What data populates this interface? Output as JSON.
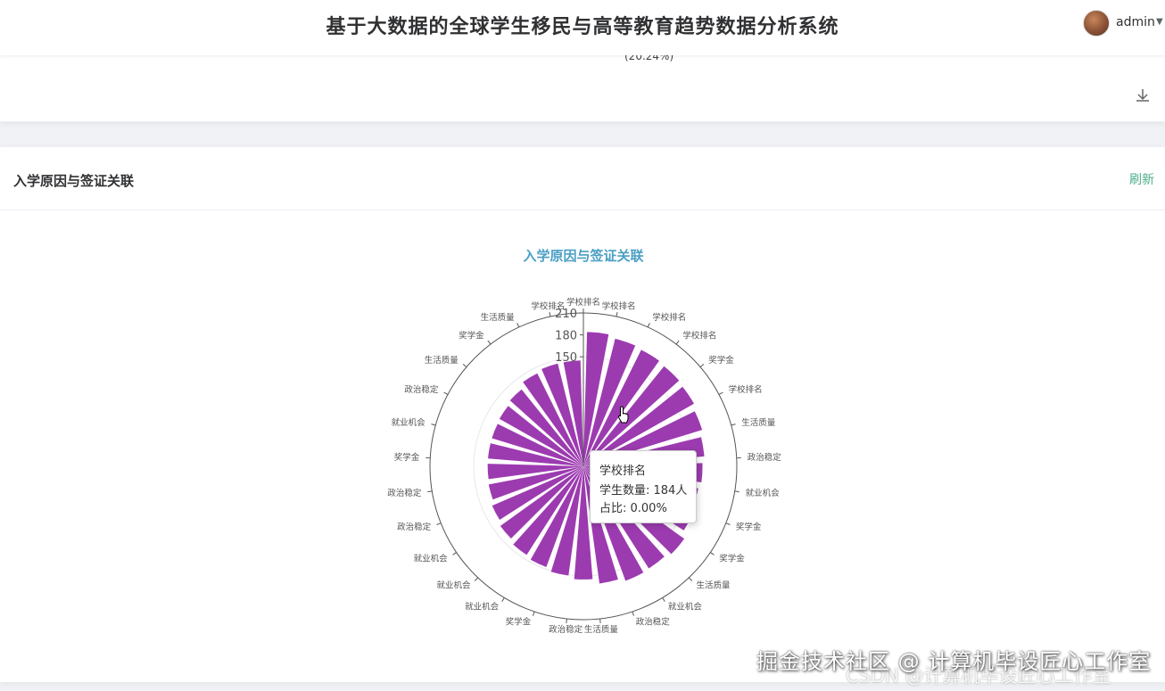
{
  "header": {
    "title": "基于大数据的全球学生移民与高等教育趋势数据分析系统",
    "username": "admin"
  },
  "prev_card": {
    "partial_text": "(20.24%)"
  },
  "card": {
    "title": "入学原因与签证关联",
    "refresh_label": "刷新"
  },
  "tooltip": {
    "name": "学校排名",
    "line1": "学生数量: 184人",
    "line2": "占比: 0.00%"
  },
  "watermark": {
    "text": "掘金技术社区 @ 计算机毕设匠心工作室",
    "text2": "CSDN @计算机毕设匠心工作室"
  },
  "icons": {
    "download": "download-icon",
    "avatar": "avatar",
    "caret": "caret-down-icon"
  },
  "colors": {
    "bar": "#9c3bb0",
    "title": "#4a9fc4",
    "refresh": "#4cae8a"
  },
  "chart_data": {
    "type": "polar-bar",
    "title": "入学原因与签证关联",
    "radius_ticks": [
      30,
      60,
      90,
      120,
      150,
      180,
      210
    ],
    "radius_tick_labels_shown": [
      150,
      180,
      210
    ],
    "rmax": 210,
    "series": [
      {
        "name": "学生数量",
        "categories": [
          "学校排名",
          "学校排名",
          "学校排名",
          "学校排名",
          "奖学金",
          "学校排名",
          "生活质量",
          "政治稳定",
          "就业机会",
          "奖学金",
          "奖学金",
          "生活质量",
          "就业机会",
          "政治稳定",
          "生活质量",
          "政治稳定",
          "奖学金",
          "就业机会",
          "就业机会",
          "就业机会",
          "政治稳定",
          "政治稳定",
          "奖学金",
          "就业机会",
          "政治稳定",
          "生活质量",
          "奖学金",
          "生活质量",
          "学校排名"
        ],
        "values": [
          184,
          180,
          178,
          176,
          174,
          170,
          166,
          163,
          160,
          163,
          170,
          166,
          167,
          162,
          155,
          151,
          147,
          144,
          140,
          136,
          132,
          131,
          131,
          131,
          132,
          135,
          142,
          145,
          145
        ]
      }
    ]
  }
}
